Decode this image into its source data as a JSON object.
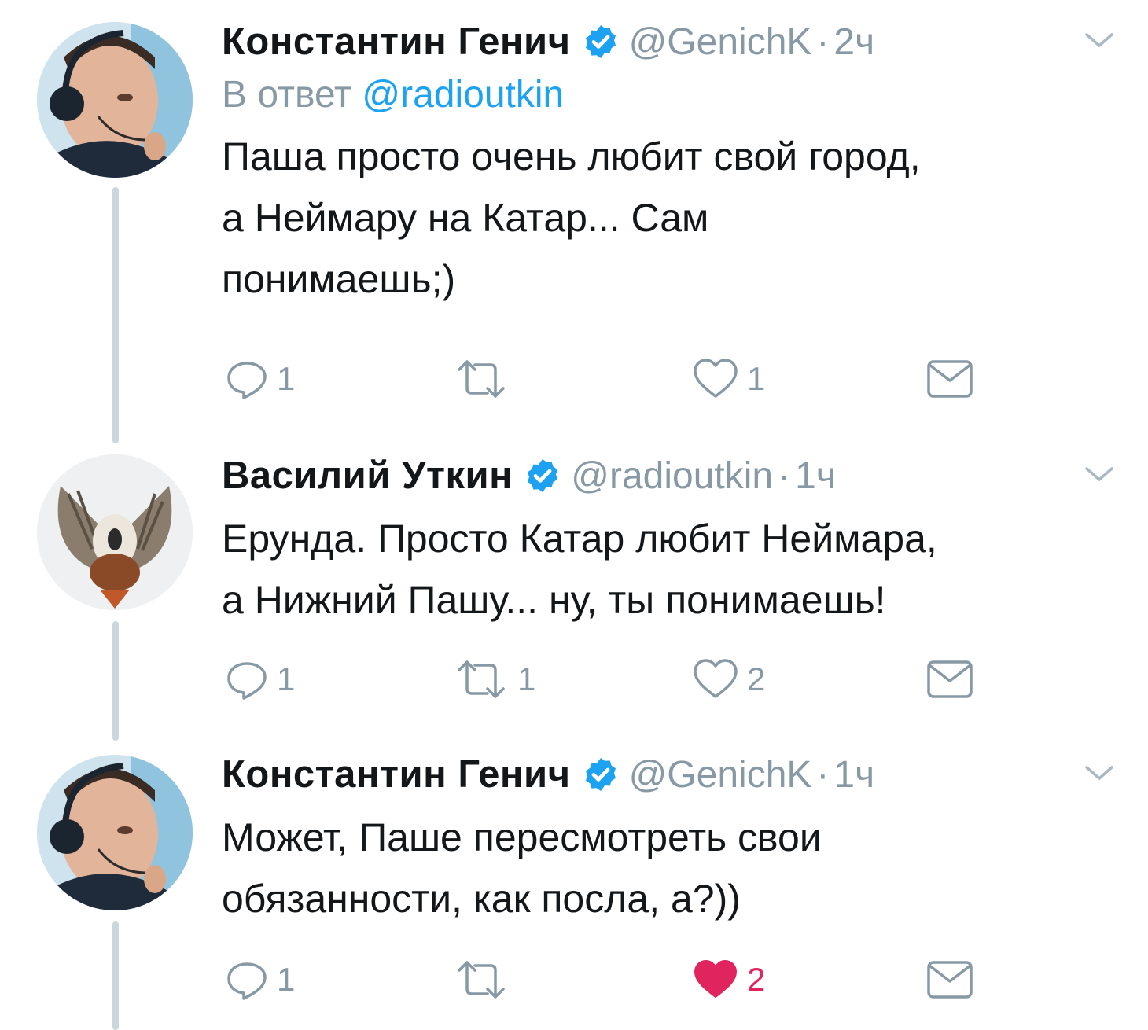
{
  "colors": {
    "accent": "#1da1f2",
    "muted": "#8899a6",
    "like_active": "#e0245e",
    "thread_line": "#ccd6dd"
  },
  "tweets": [
    {
      "name": "Константин Генич",
      "handle": "@GenichK",
      "separator": "·",
      "time": "2ч",
      "verified": true,
      "reply_prefix": "В ответ",
      "reply_to": "@radioutkin",
      "text": "Паша просто очень любит свой город,\nа Неймару на Катар... Сам\nпонимаешь;)",
      "replies": "1",
      "retweets": "",
      "likes": "1",
      "liked": false
    },
    {
      "name": "Василий Уткин",
      "handle": "@radioutkin",
      "separator": "·",
      "time": "1ч",
      "verified": true,
      "text": "Ерунда. Просто Катар любит Неймара,\nа Нижний Пашу... ну, ты понимаешь!",
      "replies": "1",
      "retweets": "1",
      "likes": "2",
      "liked": false
    },
    {
      "name": "Константин Генич",
      "handle": "@GenichK",
      "separator": "·",
      "time": "1ч",
      "verified": true,
      "text": "Может, Паше пересмотреть свои\nобязанности, как посла, а?))",
      "replies": "1",
      "retweets": "",
      "likes": "2",
      "liked": true
    }
  ],
  "icons": {
    "reply": "reply-icon",
    "retweet": "retweet-icon",
    "like": "heart-icon",
    "dm": "envelope-icon",
    "verified": "verified-badge-icon",
    "more": "chevron-down-icon"
  }
}
